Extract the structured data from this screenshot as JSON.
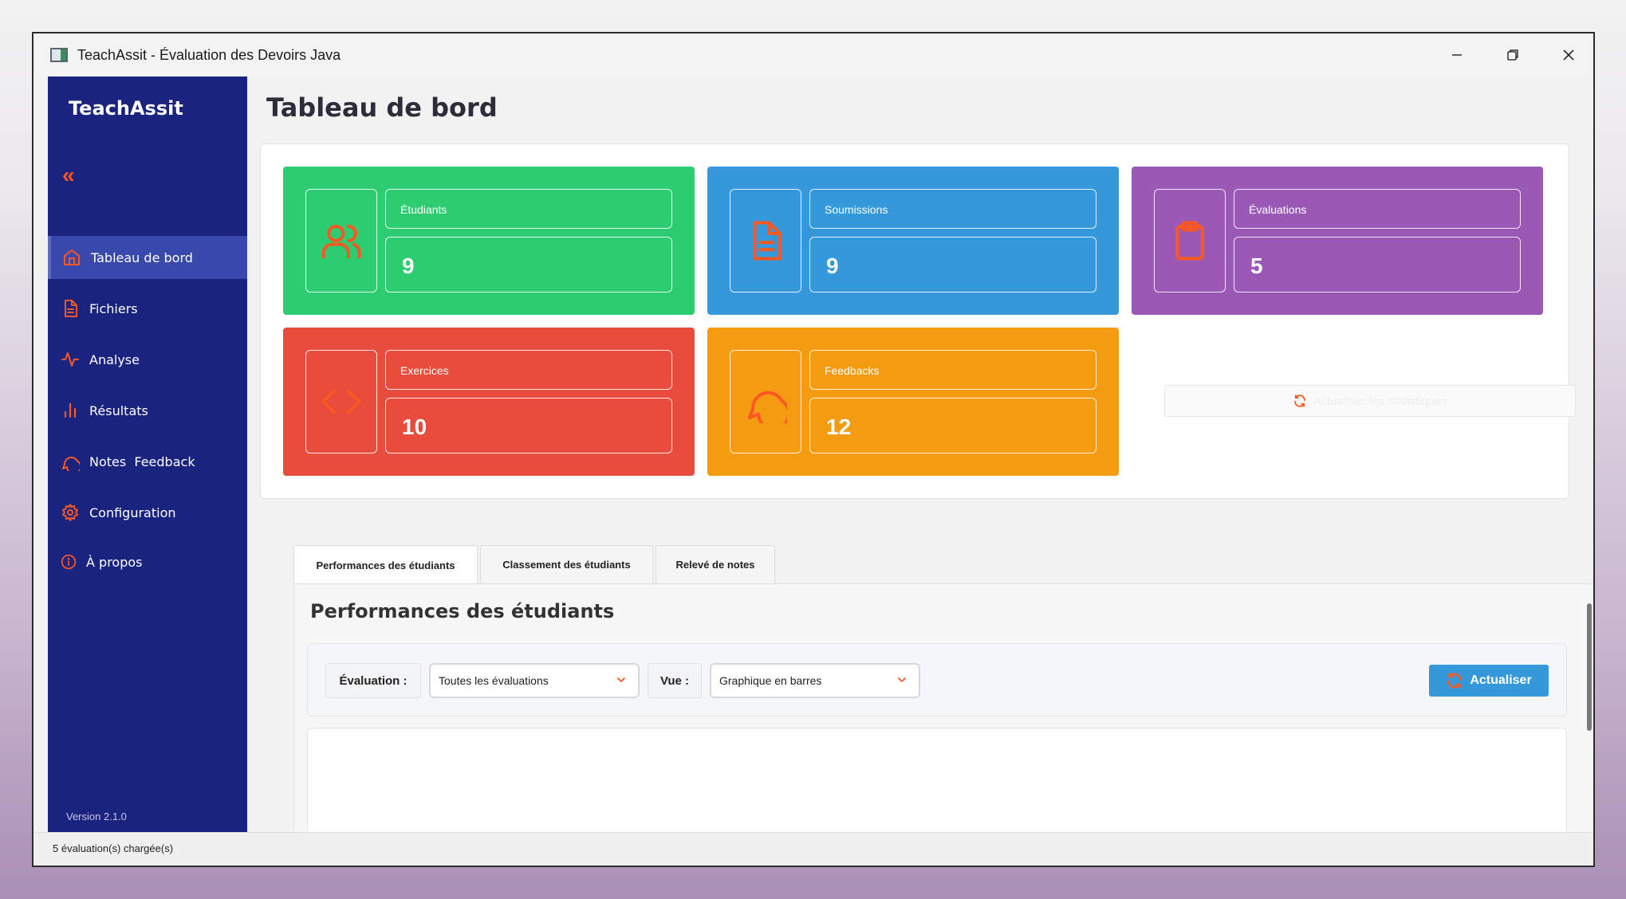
{
  "window": {
    "title": "TeachAssit - Évaluation des Devoirs Java"
  },
  "sidebar": {
    "brand": "TeachAssit",
    "collapse_glyph": "«",
    "items": [
      {
        "label": "Tableau de bord",
        "icon": "home-icon",
        "active": true
      },
      {
        "label": "Fichiers",
        "icon": "file-icon"
      },
      {
        "label": "Analyse",
        "icon": "activity-icon"
      },
      {
        "label": "Résultats",
        "icon": "bar-chart-icon"
      },
      {
        "label": "Notes  Feedback",
        "icon": "message-icon"
      },
      {
        "label": "Configuration",
        "icon": "gear-icon"
      },
      {
        "label": "À propos",
        "icon": "info-icon"
      }
    ],
    "version": "Version 2.1.0"
  },
  "main": {
    "title": "Tableau de bord",
    "stats": [
      {
        "label": "Étudiants",
        "value": "9",
        "color": "#2ecc71",
        "icon": "users-icon"
      },
      {
        "label": "Soumissions",
        "value": "9",
        "color": "#3498db",
        "icon": "file-text-icon"
      },
      {
        "label": "Évaluations",
        "value": "5",
        "color": "#9b59b6",
        "icon": "clipboard-icon"
      },
      {
        "label": "Exercices",
        "value": "10",
        "color": "#e74c3c",
        "icon": "code-icon"
      },
      {
        "label": "Feedbacks",
        "value": "12",
        "color": "#f39c12",
        "icon": "message-circle-icon"
      }
    ],
    "refresh_stats_label": "Actualiser les statistiques",
    "tabs": [
      "Performances des étudiants",
      "Classement des étudiants",
      "Relevé de notes"
    ],
    "performance": {
      "title": "Performances des étudiants",
      "evaluation_label": "Évaluation :",
      "evaluation_value": "Toutes les évaluations",
      "view_label": "Vue :",
      "view_value": "Graphique en barres",
      "refresh_label": "Actualiser"
    }
  },
  "statusbar": {
    "text": "5 évaluation(s) chargée(s)"
  },
  "colors": {
    "sidebar_bg": "#1a237e",
    "sidebar_active": "#3949ab",
    "accent_icon": "#ff5722",
    "button_blue": "#3498db"
  }
}
